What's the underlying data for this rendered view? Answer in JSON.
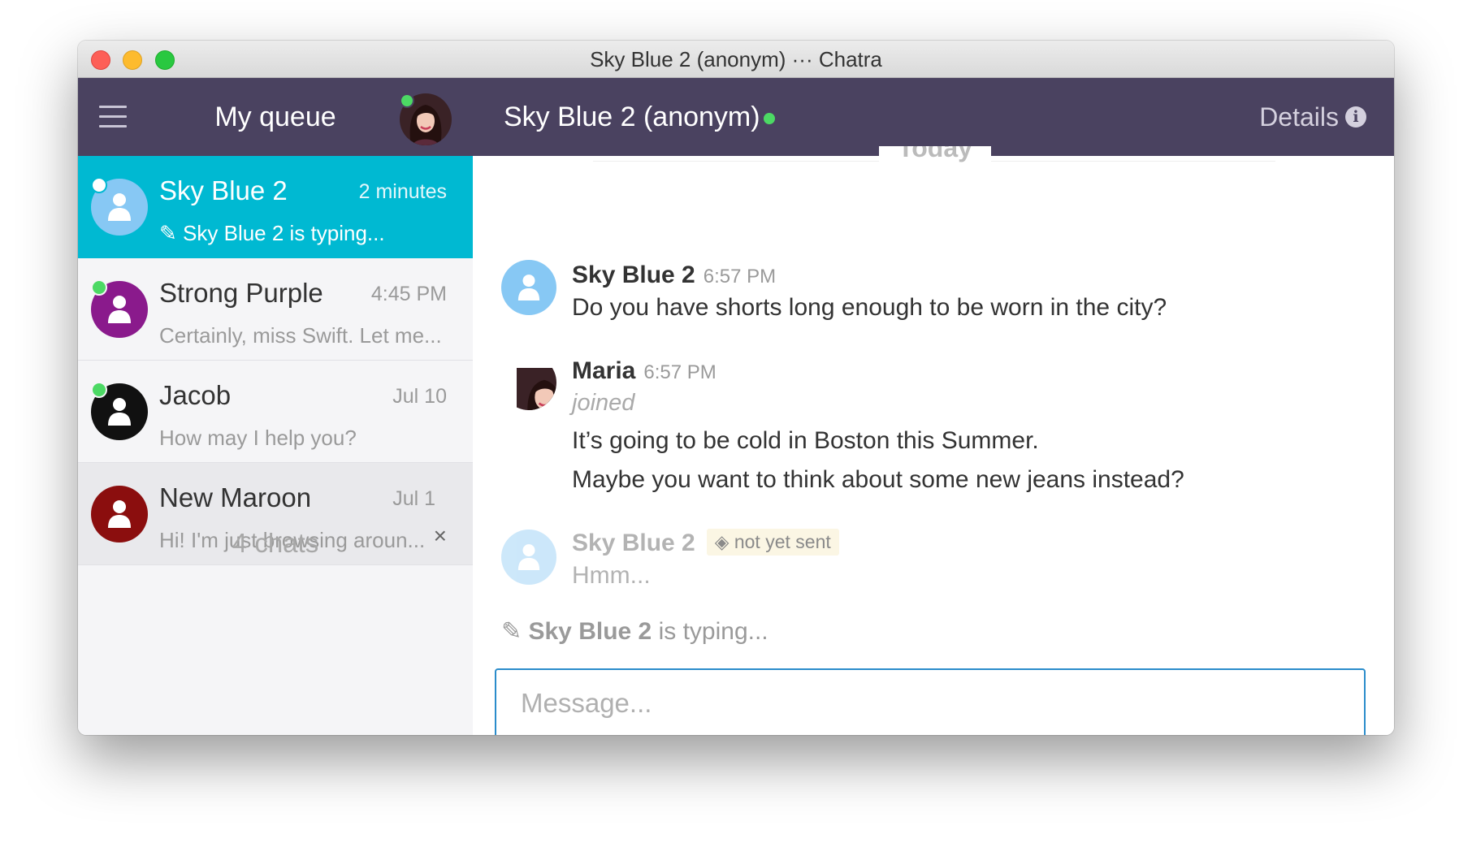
{
  "window": {
    "title": "Sky Blue 2 (anonym) ··· Chatra"
  },
  "sidebar": {
    "title": "My queue",
    "chats": [
      {
        "name": "Sky Blue 2",
        "time": "2 minutes",
        "preview": "Sky Blue 2 is typing...",
        "avatar_color": "#87c8f4",
        "status_color": "#ffffff",
        "active": true
      },
      {
        "name": "Strong Purple",
        "time": "4:45 PM",
        "preview": "Certainly, miss Swift. Let me...",
        "avatar_color": "#8a1a8c",
        "status_color": "#4cd964"
      },
      {
        "name": "Jacob",
        "time": "Jul 10",
        "preview": "How may I help you?",
        "avatar_color": "#111111",
        "status_color": "#4cd964"
      },
      {
        "name": "New Maroon",
        "time": "Jul 1",
        "preview": "Hi! I'm just browsing aroun...",
        "avatar_color": "#8b0e0e",
        "close_label": "×"
      }
    ],
    "count_label": "4 chats"
  },
  "main": {
    "contact_title": "Sky Blue 2 (anonym)",
    "details_label": "Details",
    "details_icon": "info-icon",
    "date_divider": "Today",
    "messages": [
      {
        "author": "Sky Blue 2",
        "time": "6:57 PM",
        "lines": [
          "Do you have shorts long enough to be worn in the city?"
        ]
      },
      {
        "author": "Maria",
        "time": "6:57 PM",
        "event": "joined",
        "lines": [
          "It’s going to be cold in Boston this Summer.",
          "Maybe you want to think about some new jeans instead?"
        ]
      },
      {
        "author": "Sky Blue 2",
        "status": "not yet sent",
        "lines": [
          "Hmm..."
        ]
      }
    ],
    "typing": {
      "name": "Sky Blue 2",
      "suffix": " is typing..."
    },
    "composer": {
      "placeholder": "Message...",
      "value": ""
    }
  },
  "colors": {
    "header": "#4a4260",
    "active_chat": "#00b9d2",
    "online": "#4cd964",
    "composer_border": "#2a8ccb"
  }
}
